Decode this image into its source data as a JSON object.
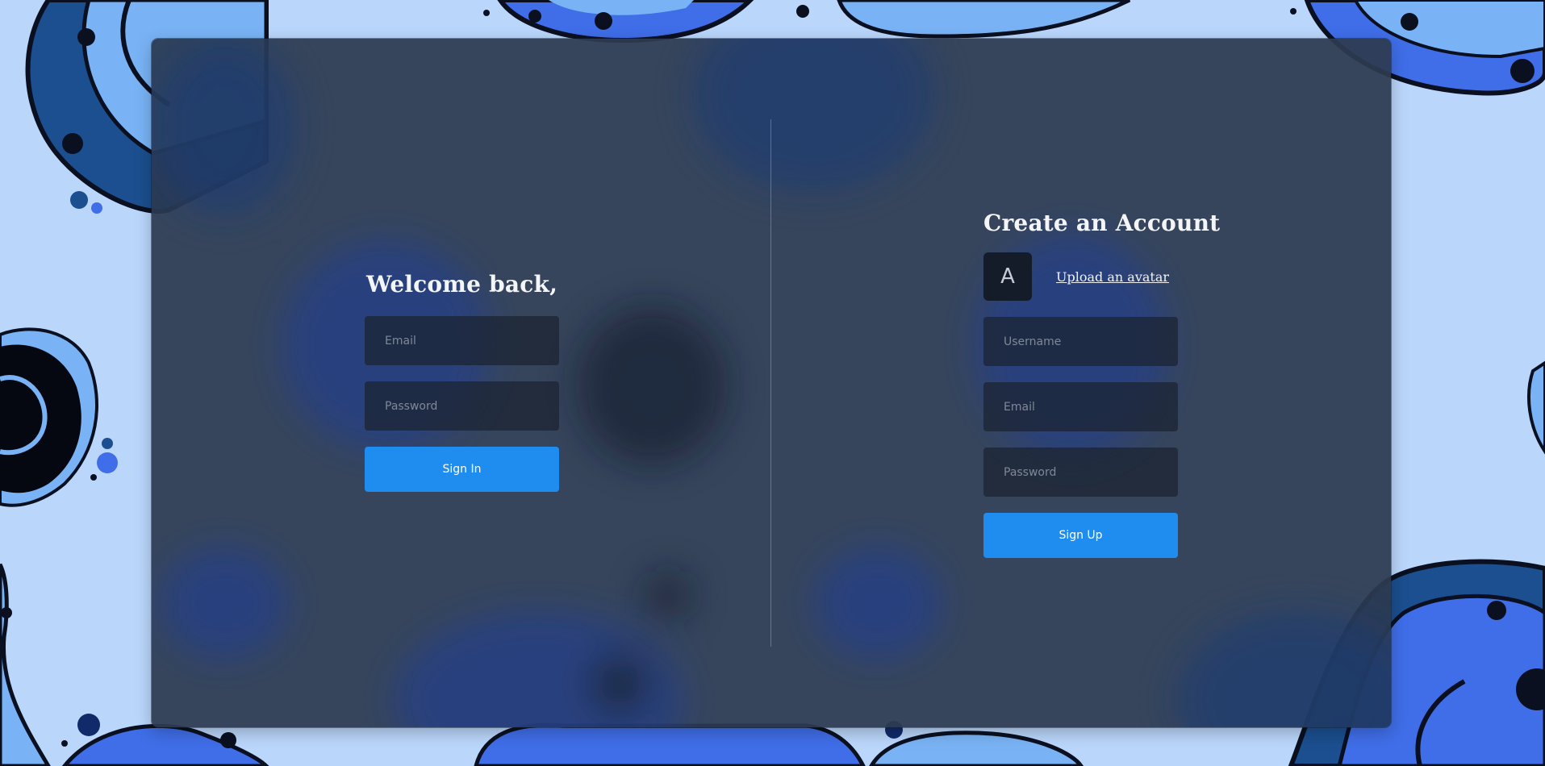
{
  "signin": {
    "title": "Welcome back,",
    "email_placeholder": "Email",
    "password_placeholder": "Password",
    "button_label": "Sign In"
  },
  "signup": {
    "title": "Create an Account",
    "avatar_letter": "A",
    "upload_label": "Upload an avatar",
    "username_placeholder": "Username",
    "email_placeholder": "Email",
    "password_placeholder": "Password",
    "button_label": "Sign Up"
  },
  "colors": {
    "page_background": "#bad6fb",
    "panel": "#2d3a50",
    "input_fill": "#1c2534",
    "button": "#1f8df0",
    "blob_blue": "#3f6ee8",
    "blob_light": "#79b3f5",
    "blob_dark": "#123a78"
  }
}
